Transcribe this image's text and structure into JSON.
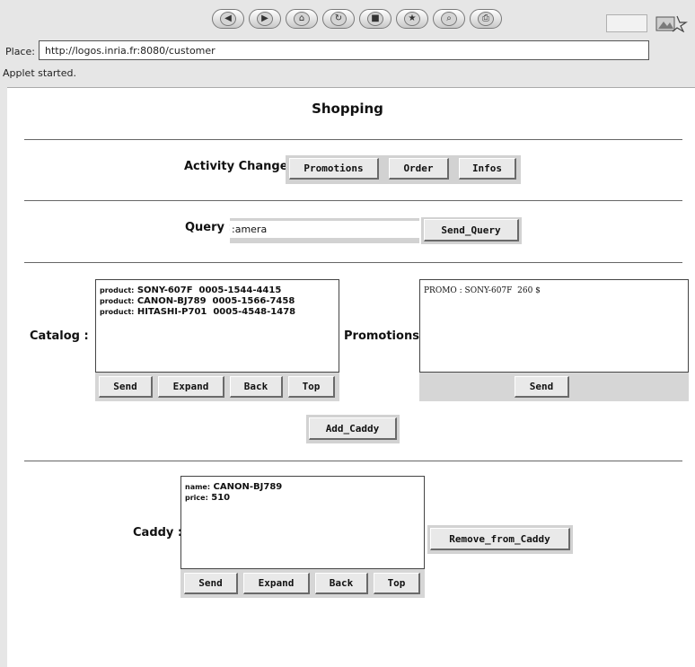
{
  "browser": {
    "nav_icons": [
      "back-icon",
      "forward-icon",
      "home-icon",
      "reload-icon",
      "stop-icon",
      "bookmark-star-icon",
      "search-icon",
      "print-icon"
    ],
    "place_label": "Place:",
    "url": "http://logos.inria.fr:8080/customer",
    "status": "Applet started."
  },
  "page": {
    "title": "Shopping",
    "activity": {
      "label": "Activity Change :",
      "buttons": [
        "Promotions",
        "Order",
        "Infos"
      ]
    },
    "query": {
      "label": "Query :",
      "value": ":amera",
      "button": "Send_Query"
    },
    "catalog": {
      "label": "Catalog :",
      "items": [
        {
          "key": "product:",
          "text": "SONY-607F  0005-1544-4415"
        },
        {
          "key": "product:",
          "text": "CANON-BJ789  0005-1566-7458"
        },
        {
          "key": "product:",
          "text": "HITASHI-P701  0005-4548-1478"
        }
      ],
      "buttons": [
        "Send",
        "Expand",
        "Back",
        "Top"
      ]
    },
    "promotions": {
      "label": "Promotions :",
      "items": [
        "PROMO : SONY-607F  260 $"
      ],
      "button": "Send"
    },
    "add_caddy_button": "Add_Caddy",
    "caddy": {
      "label": "Caddy :",
      "items": [
        {
          "key": "name:",
          "text": "CANON-BJ789"
        },
        {
          "key": "price:",
          "text": "510"
        }
      ],
      "buttons": [
        "Send",
        "Expand",
        "Back",
        "Top"
      ],
      "remove_button": "Remove_from_Caddy"
    }
  }
}
